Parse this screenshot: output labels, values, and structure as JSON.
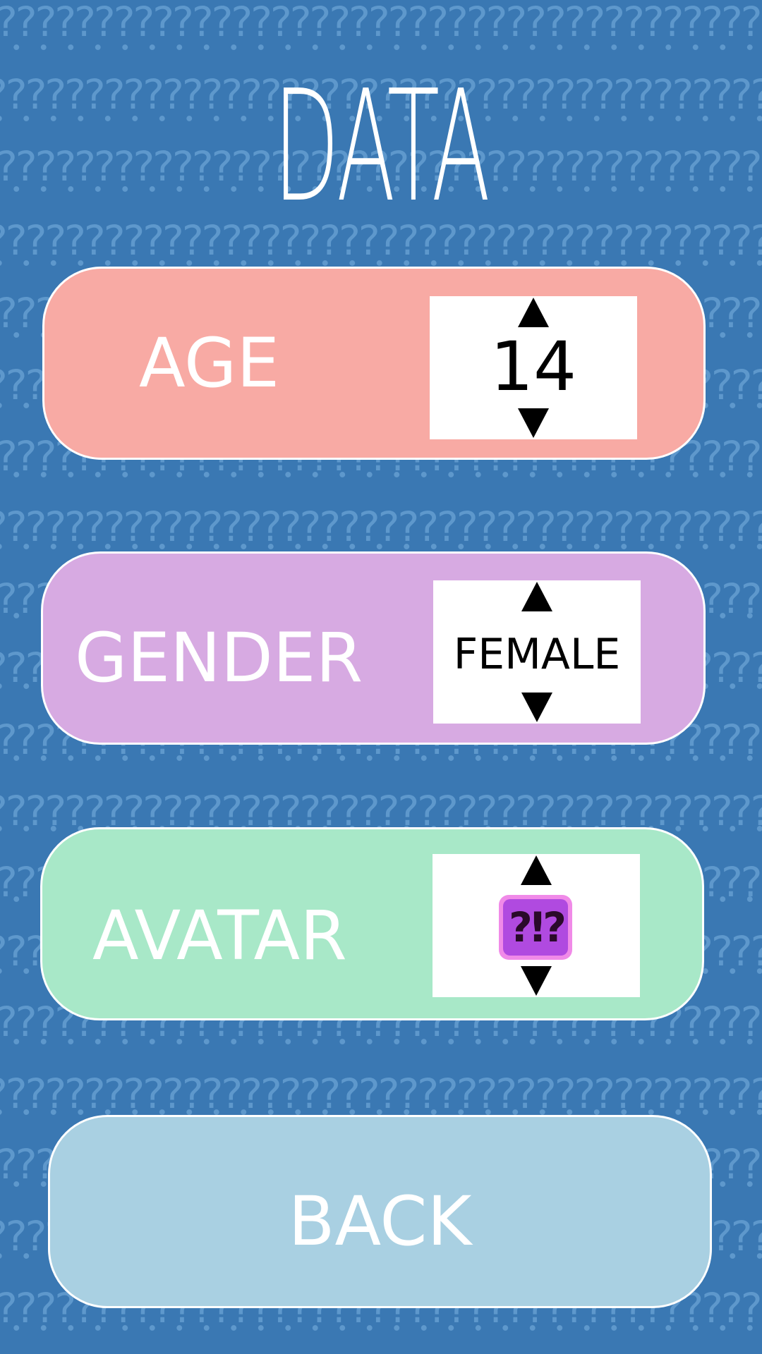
{
  "screen": {
    "title": "DATA",
    "background_color": "#3a78b3",
    "pattern_glyph": "?"
  },
  "age": {
    "label": "AGE",
    "value": "14",
    "color": "#f8aaa4"
  },
  "gender": {
    "label": "GENDER",
    "value": "FEMALE",
    "color": "#d7aae2"
  },
  "avatar": {
    "label": "AVATAR",
    "icon": "avatar-icon",
    "icon_text": "?!?",
    "color": "#a8e8c8"
  },
  "back": {
    "label": "BACK",
    "color": "#a9d0e2"
  }
}
